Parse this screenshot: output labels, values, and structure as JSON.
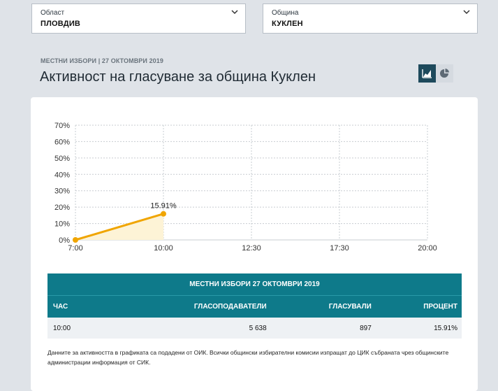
{
  "filters": {
    "oblast": {
      "label": "Област",
      "value": "ПЛОВДИВ"
    },
    "obshtina": {
      "label": "Община",
      "value": "КУКЛЕН"
    }
  },
  "header": {
    "kicker": "МЕСТНИ ИЗБОРИ | 27 ОКТОМВРИ 2019",
    "title": "Активност на гласуване за община Куклен"
  },
  "view_toggle": {
    "active": "line-chart-icon",
    "inactive": "pie-chart-icon"
  },
  "chart_data": {
    "type": "area",
    "x_ticks": [
      "7:00",
      "10:00",
      "12:30",
      "17:30",
      "20:00"
    ],
    "y_ticks": [
      "0%",
      "10%",
      "20%",
      "30%",
      "40%",
      "50%",
      "60%",
      "70%"
    ],
    "ylim": [
      0,
      70
    ],
    "series": [
      {
        "x": [
          "7:00",
          "10:00"
        ],
        "values": [
          0,
          15.91
        ]
      }
    ],
    "data_labels": [
      "15.91%"
    ],
    "grid": true,
    "color": "#f0a500",
    "fill": "#fdf3d6"
  },
  "table": {
    "caption": "МЕСТНИ ИЗБОРИ 27 ОКТОМВРИ 2019",
    "headers": [
      "ЧАС",
      "ГЛАСОПОДАВАТЕЛИ",
      "ГЛАСУВАЛИ",
      "ПРОЦЕНТ"
    ],
    "rows": [
      [
        "10:00",
        "5 638",
        "897",
        "15.91%"
      ]
    ]
  },
  "note": "Данните за активността в графиката са подадени от ОИК. Всички общински избирателни комисии изпращат до ЦИК събраната чрез общинските администрации информация от СИК.",
  "colors": {
    "teal": "#0e7a8a",
    "accent": "#f0a500",
    "dark": "#1e4a5c"
  }
}
